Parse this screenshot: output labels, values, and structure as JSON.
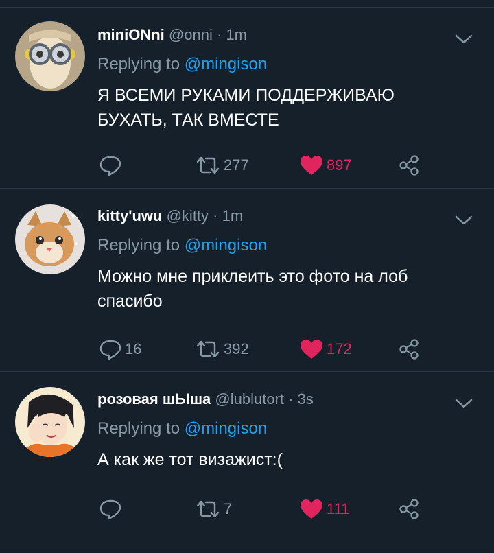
{
  "tweets": [
    {
      "name": "miniONni",
      "handle": "@onni",
      "separator": "·",
      "time": "1m",
      "replying_to_label": "Replying to",
      "replying_to_handle": "@mingison",
      "text_line1": "Я ВСЕМИ РУКАМИ ПОДДЕРЖИВАЮ",
      "text_line2": "БУХАТЬ, ТАК ВМЕСТЕ",
      "reply_count": "",
      "retweet_count": "277",
      "like_count": "897",
      "liked": true
    },
    {
      "name": "kitty'uwu",
      "handle": "@kitty",
      "separator": "·",
      "time": "1m",
      "replying_to_label": "Replying to",
      "replying_to_handle": "@mingison",
      "text_line1": "Можно мне приклеить это фото на лоб",
      "text_line2": "спасибо",
      "reply_count": "16",
      "retweet_count": "392",
      "like_count": "172",
      "liked": true
    },
    {
      "name": "розовая шЫша",
      "handle": "@lublutort",
      "separator": "·",
      "time": "3s",
      "replying_to_label": "Replying to",
      "replying_to_handle": "@mingison",
      "text_line1": "А как же тот визажист:(",
      "text_line2": "",
      "reply_count": "",
      "retweet_count": "7",
      "like_count": "111",
      "liked": true
    }
  ],
  "colors": {
    "background": "#15202b",
    "divider": "#2b3845",
    "secondary_text": "#8899a6",
    "mention": "#1da1f2",
    "like": "#e0245e"
  },
  "icons": [
    "reply-icon",
    "retweet-icon",
    "like-heart-icon",
    "share-icon",
    "chevron-down-icon"
  ]
}
